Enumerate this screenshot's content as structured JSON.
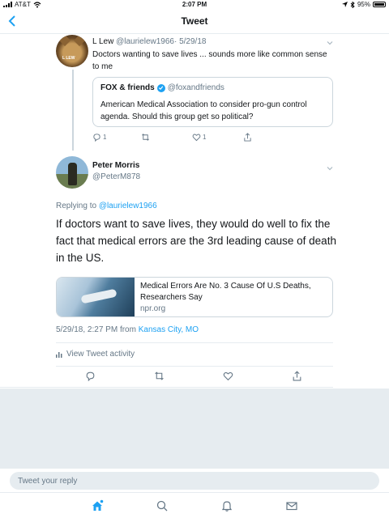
{
  "status_bar": {
    "carrier": "AT&T",
    "time": "2:07 PM",
    "battery": "95%",
    "battery_level": 0.95
  },
  "nav": {
    "title": "Tweet",
    "back_icon": "chevron-left-icon"
  },
  "parent_tweet": {
    "name": "L Lew",
    "handle": "@laurielew1966",
    "date": "· 5/29/18",
    "text": "Doctors wanting to save lives ... sounds more like common sense to me",
    "avatar_label": "L LEW",
    "quoted": {
      "name": "FOX & friends",
      "handle": "@foxandfriends",
      "text": "American Medical Association to consider pro-gun control agenda. Should this group get so political?"
    },
    "actions": {
      "reply_count": "1",
      "like_count": "1"
    }
  },
  "main_tweet": {
    "name": "Peter Morris",
    "handle": "@PeterM878",
    "replying_prefix": "Replying to ",
    "replying_to": "@laurielew1966",
    "text": "If doctors want to save lives, they would do well to fix the fact that medical errors are the 3rd leading cause of death in the US.",
    "card": {
      "title": "Medical Errors Are No. 3 Cause Of U.S Deaths, Researchers Say",
      "domain": "npr.org"
    },
    "timestamp": "5/29/18, 2:27 PM from ",
    "location": "Kansas City, MO",
    "activity": "View Tweet activity"
  },
  "reply": {
    "placeholder": "Tweet your reply"
  },
  "colors": {
    "accent": "#1da1f2",
    "secondary_text": "#657786",
    "border": "#e6ecf0"
  }
}
